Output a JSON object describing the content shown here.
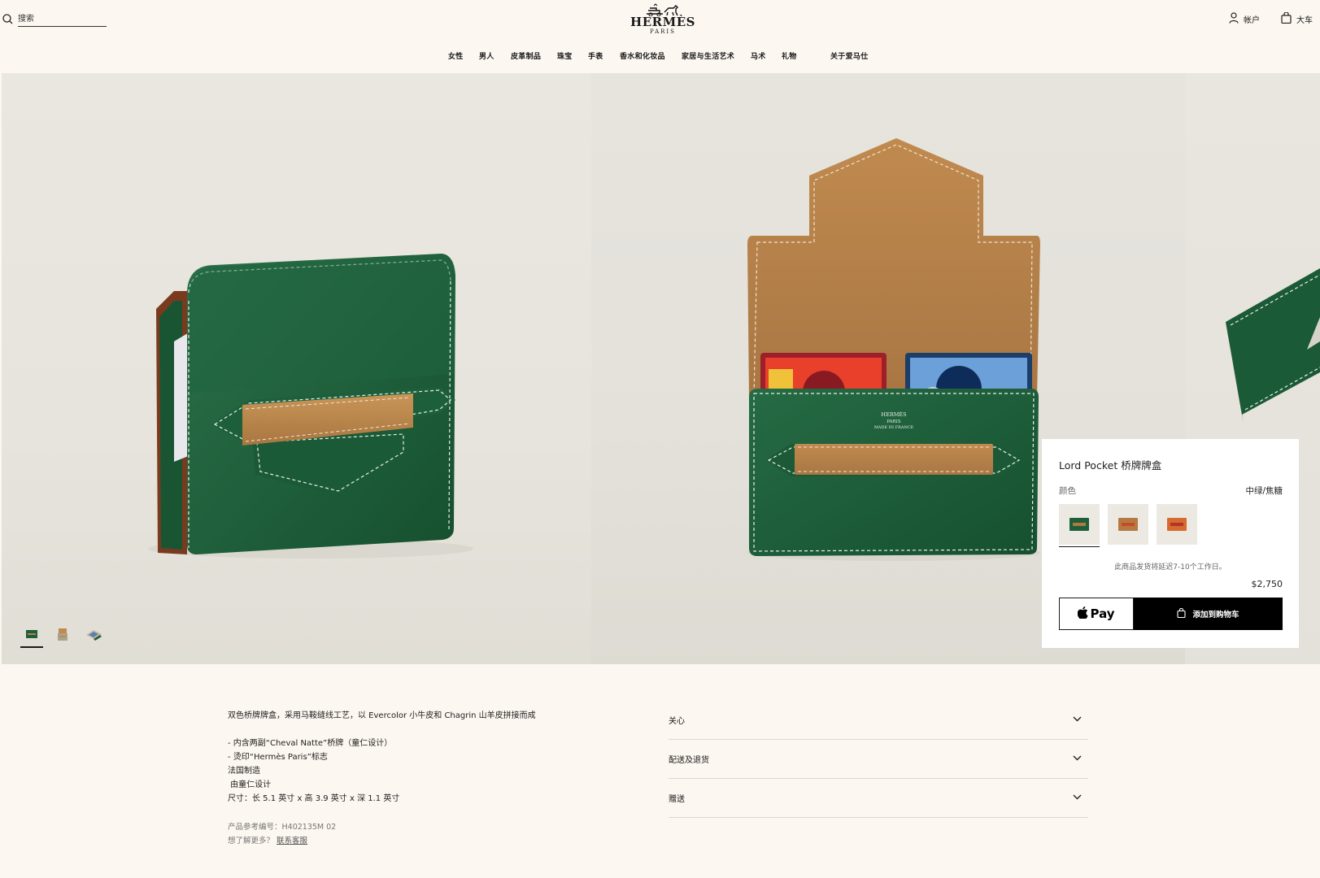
{
  "header": {
    "search_placeholder": "搜索",
    "brand": "HERMÈS",
    "brand_sub": "PARIS",
    "account_label": "帐户",
    "cart_label": "大车"
  },
  "nav": {
    "items": [
      {
        "label": "女性"
      },
      {
        "label": "男人"
      },
      {
        "label": "皮革制品"
      },
      {
        "label": "珠宝"
      },
      {
        "label": "手表"
      },
      {
        "label": "香水和化妆品"
      },
      {
        "label": "家居与生活艺术"
      },
      {
        "label": "马术"
      },
      {
        "label": "礼物"
      },
      {
        "label": "关于爱马仕"
      }
    ]
  },
  "product_inner_stamp": [
    "HERMÈS",
    "PARIS",
    "MADE IN FRANCE"
  ],
  "card": {
    "title": "Lord Pocket 桥牌牌盒",
    "color_label": "颜色",
    "color_value": "中绿/焦糖",
    "swatches": [
      {
        "name": "green-caramel",
        "color": "#1f5e3a",
        "strap": "#b07a3c"
      },
      {
        "name": "tan-red",
        "color": "#b57a44",
        "strap": "#c94a26"
      },
      {
        "name": "orange-red",
        "color": "#d76a2e",
        "strap": "#b2342a"
      }
    ],
    "shipping_note": "此商品发货将延迟7-10个工作日。",
    "price": "$2,750",
    "applepay_label": "Pay",
    "add_to_cart_label": "添加到购物车"
  },
  "description": {
    "intro": "双色桥牌牌盒，采用马鞍缝线工艺，以 Evercolor 小牛皮和 Chagrin 山羊皮拼接而成",
    "lines": [
      "- 内含两副“Cheval Natte”桥牌（童仁设计）",
      "- 烫印“Hermès Paris”标志",
      "法国制造",
      " 由童仁设计",
      "尺寸：长 5.1 英寸 x 高 3.9 英寸 x 深 1.1 英寸"
    ],
    "ref_label": "产品参考编号：H402135M 02",
    "more_label": "想了解更多？",
    "contact_link": "联系客服"
  },
  "accordion": {
    "items": [
      {
        "label": "关心"
      },
      {
        "label": "配送及退货"
      },
      {
        "label": "赠送"
      }
    ]
  },
  "colors": {
    "background": "#fcf7f1",
    "green_leather": "#1f5e3a",
    "caramel": "#b5824a",
    "button_black": "#000000"
  }
}
